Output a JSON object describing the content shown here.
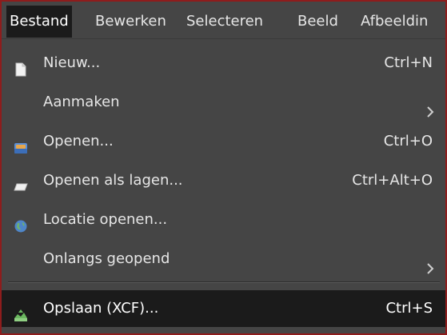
{
  "menubar": {
    "items": [
      {
        "label": "Bestand",
        "active": true
      },
      {
        "label": "Bewerken"
      },
      {
        "label": "Selecteren"
      },
      {
        "label": "Beeld"
      },
      {
        "label": "Afbeeldin"
      }
    ]
  },
  "file_menu": {
    "items": [
      {
        "label": "Nieuw...",
        "shortcut": "Ctrl+N",
        "icon": "new-image-icon"
      },
      {
        "label": "Aanmaken",
        "submenu": true
      },
      {
        "label": "Openen...",
        "shortcut": "Ctrl+O",
        "icon": "open-folder-icon"
      },
      {
        "label": "Openen als lagen...",
        "shortcut": "Ctrl+Alt+O",
        "icon": "open-as-layers-icon"
      },
      {
        "label": "Locatie openen...",
        "icon": "globe-icon"
      },
      {
        "label": "Onlangs geopend",
        "submenu": true
      },
      {
        "label": "Opslaan (XCF)...",
        "shortcut": "Ctrl+S",
        "icon": "save-icon",
        "highlighted": true
      }
    ]
  },
  "colors": {
    "menu_background": "#454545",
    "highlight_background": "#1b1b1b",
    "text": "#e6e6e6",
    "frame_border": "#8e1c1c"
  }
}
